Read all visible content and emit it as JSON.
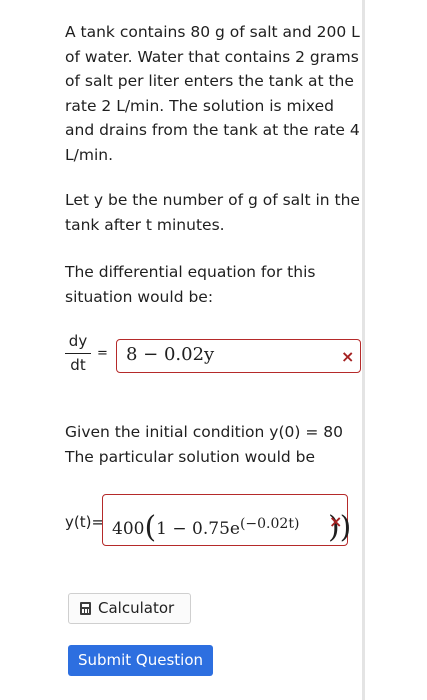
{
  "problem": {
    "statement": "A tank contains 80 g of salt and 200 L of water. Water that contains 2 grams of salt per liter enters the tank at the rate 2 L/min. The solution is mixed and drains from the tank at the rate 4 L/min.",
    "definition": "Let y be the number of g of salt in the tank after t minutes.",
    "de_prompt": "The differential equation for this situation would be:",
    "ic_prompt": "Given the initial condition y(0) = 80 The particular solution would be"
  },
  "derivative": {
    "numerator": "dy",
    "denominator": "dt",
    "equals": "="
  },
  "answer1": {
    "value": "8 − 0.02y",
    "status": "×"
  },
  "answer2": {
    "label": "y(t)=",
    "coef": "400",
    "open": "(",
    "inner": "1 − 0.75e",
    "exponent": "(−0.02t)",
    "close": ")",
    "status": "×"
  },
  "buttons": {
    "calculator": "Calculator",
    "submit": "Submit Question"
  },
  "icons": {
    "calculator": "calculator-icon",
    "incorrect": "close-icon"
  },
  "colors": {
    "submit_bg": "#2d6fe0",
    "error": "#b52a2a"
  }
}
